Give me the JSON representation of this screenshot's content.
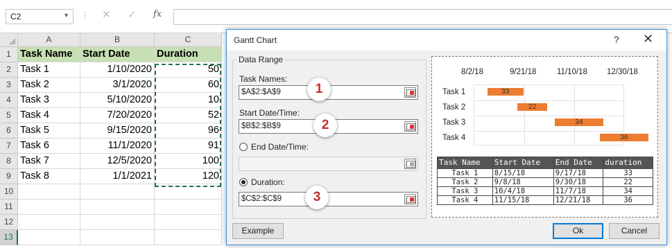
{
  "formula_bar": {
    "name_box": "C2",
    "fx_label": "fx",
    "cancel_icon": "✕",
    "enter_icon": "✓"
  },
  "columns": [
    "A",
    "B",
    "C"
  ],
  "rows": [
    "1",
    "2",
    "3",
    "4",
    "5",
    "6",
    "7",
    "8",
    "9",
    "10",
    "11",
    "12",
    "13"
  ],
  "selected_row": "13",
  "sheet": {
    "headers": [
      "Task Name",
      "Start Date",
      "Duration"
    ],
    "data": [
      [
        "Task 1",
        "1/10/2020",
        "50"
      ],
      [
        "Task 2",
        "3/1/2020",
        "60"
      ],
      [
        "Task 3",
        "5/10/2020",
        "10"
      ],
      [
        "Task 4",
        "7/20/2020",
        "52"
      ],
      [
        "Task 5",
        "9/15/2020",
        "96"
      ],
      [
        "Task 6",
        "11/1/2020",
        "91"
      ],
      [
        "Task 7",
        "12/5/2020",
        "100"
      ],
      [
        "Task 8",
        "1/1/2021",
        "120"
      ]
    ],
    "header_fill": "#c6e0b4"
  },
  "dialog": {
    "title": "Gantt Chart",
    "help": "?",
    "close": "✕",
    "group_label": "Data Range",
    "task_names_label": "Task Names:",
    "task_names_value": "$A$2:$A$9",
    "start_label": "Start Date/Time:",
    "start_value": "$B$2:$B$9",
    "end_label": "End Date/Time:",
    "end_value": "",
    "duration_label": "Duration:",
    "duration_value": "$C$2:$C$9",
    "end_selected": false,
    "duration_selected": true,
    "badges": [
      "1",
      "2",
      "3"
    ],
    "example_button": "Example",
    "ok_button": "Ok",
    "cancel_button": "Cancel"
  },
  "preview": {
    "date_labels": [
      "8/2/18",
      "9/21/18",
      "11/10/18",
      "12/30/18"
    ],
    "tasks": [
      {
        "name": "Task 1",
        "start_frac": 0.09,
        "end_frac": 0.33,
        "label": "33"
      },
      {
        "name": "Task 2",
        "start_frac": 0.29,
        "end_frac": 0.49,
        "label": "22"
      },
      {
        "name": "Task 3",
        "start_frac": 0.54,
        "end_frac": 0.86,
        "label": "34"
      },
      {
        "name": "Task 4",
        "start_frac": 0.84,
        "end_frac": 1.16,
        "label": "36"
      }
    ],
    "bar_color": "#ed7d31",
    "table": {
      "headers": [
        "Task Name",
        "Start Date",
        "End Date",
        "duration"
      ],
      "rows": [
        [
          "Task 1",
          "8/15/18",
          "9/17/18",
          "33"
        ],
        [
          "Task 2",
          "9/8/18",
          "9/30/18",
          "22"
        ],
        [
          "Task 3",
          "10/4/18",
          "11/7/18",
          "34"
        ],
        [
          "Task 4",
          "11/15/18",
          "12/21/18",
          "36"
        ]
      ]
    }
  }
}
